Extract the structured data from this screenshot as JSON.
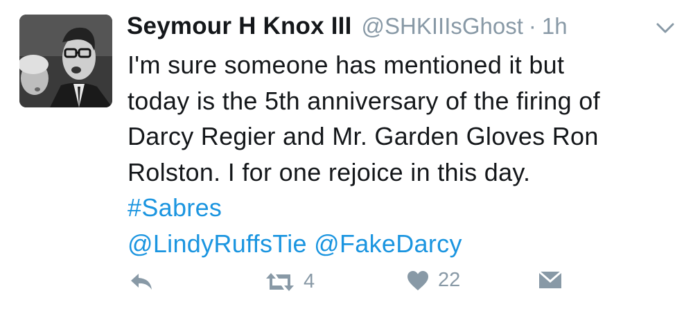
{
  "tweet": {
    "display_name": "Seymour H Knox III",
    "handle": "@SHKIIIsGhost",
    "separator": "·",
    "time": "1h",
    "body_lines": [
      "I'm sure someone has mentioned it but",
      "today is the 5th anniversary of the firing of",
      "Darcy Regier and Mr. Garden Gloves Ron",
      "Rolston. I for one rejoice in this day."
    ],
    "hashtag": "#Sabres",
    "mention_1": "@LindyRuffsTie",
    "mention_2": "@FakeDarcy"
  },
  "actions": {
    "reply_icon": "reply-icon",
    "retweet_icon": "retweet-icon",
    "retweet_count": "4",
    "like_icon": "heart-icon",
    "like_count": "22",
    "dm_icon": "envelope-icon"
  },
  "colors": {
    "link": "#1b95e0",
    "muted": "#8899a6",
    "text": "#14171a"
  }
}
